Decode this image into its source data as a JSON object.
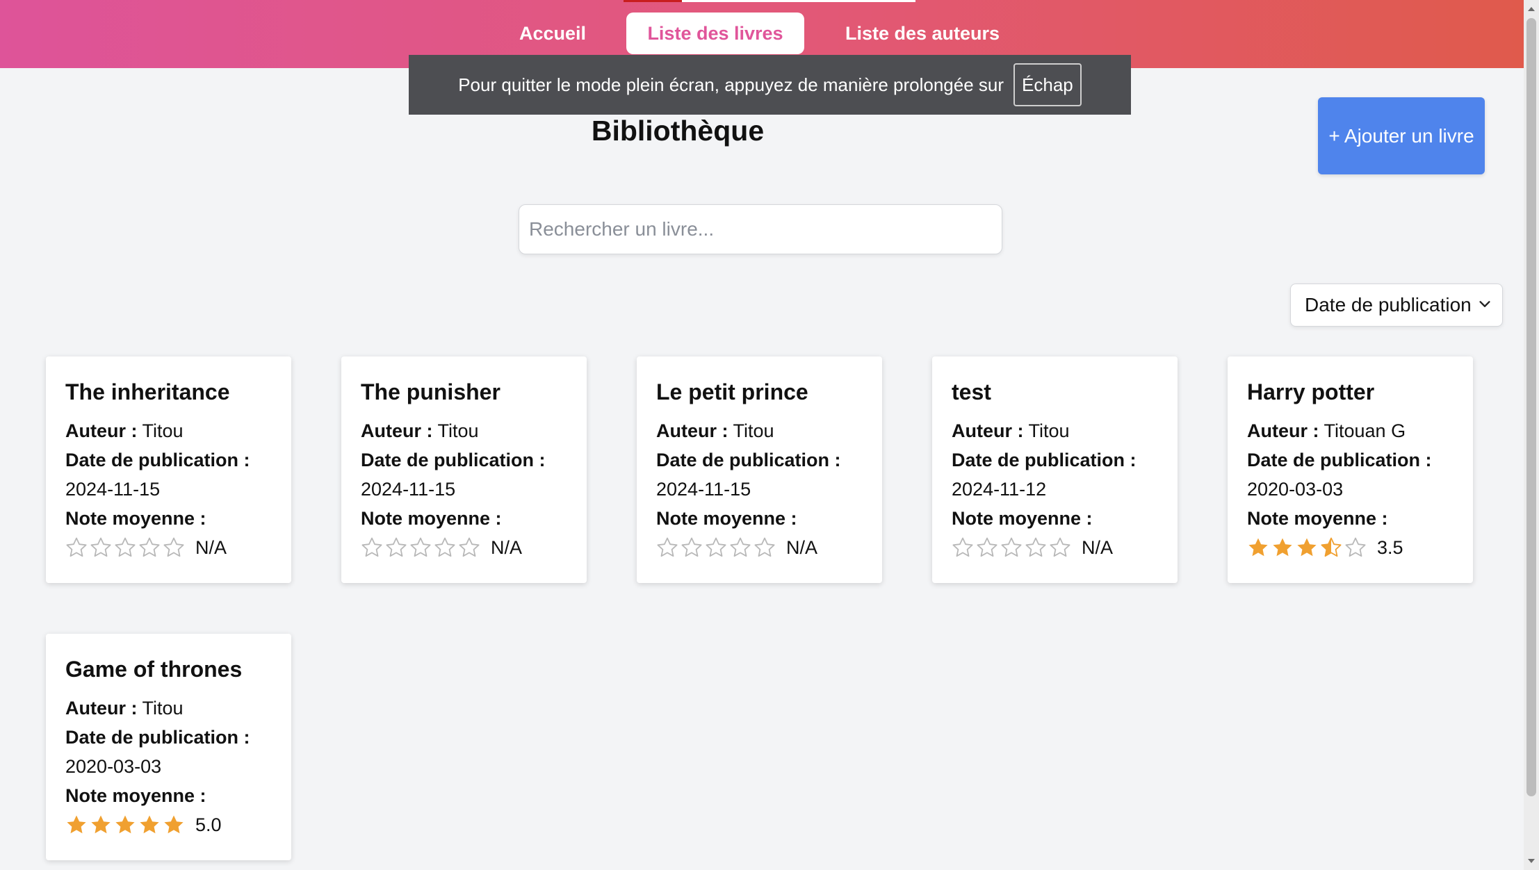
{
  "nav": {
    "links": [
      {
        "label": "Accueil",
        "active": false
      },
      {
        "label": "Liste des livres",
        "active": true
      },
      {
        "label": "Liste des auteurs",
        "active": false
      }
    ]
  },
  "fullscreen_toast": {
    "message": "Pour quitter le mode plein écran, appuyez de manière prolongée sur",
    "key": "Échap"
  },
  "page": {
    "title": "Bibliothèque",
    "add_button": "+ Ajouter un livre",
    "search_placeholder": "Rechercher un livre...",
    "sort_selected": "Date de publication"
  },
  "labels": {
    "author": "Auteur :",
    "date": "Date de publication :",
    "rating": "Note moyenne :"
  },
  "books": [
    {
      "title": "The inheritance",
      "author": "Titou",
      "date": "2024-11-15",
      "rating": null,
      "rating_text": "N/A"
    },
    {
      "title": "The punisher",
      "author": "Titou",
      "date": "2024-11-15",
      "rating": null,
      "rating_text": "N/A"
    },
    {
      "title": "Le petit prince",
      "author": "Titou",
      "date": "2024-11-15",
      "rating": null,
      "rating_text": "N/A"
    },
    {
      "title": "test",
      "author": "Titou",
      "date": "2024-11-12",
      "rating": null,
      "rating_text": "N/A"
    },
    {
      "title": "Harry potter",
      "author": "Titouan G",
      "date": "2020-03-03",
      "rating": 3.5,
      "rating_text": "3.5"
    },
    {
      "title": "Game of thrones",
      "author": "Titou",
      "date": "2020-03-03",
      "rating": 5.0,
      "rating_text": "5.0"
    }
  ],
  "colors": {
    "accent_pink": "#e0559a",
    "button_blue": "#4f84ec",
    "star_filled": "#f0a030",
    "star_empty": "#b8b8b8"
  }
}
